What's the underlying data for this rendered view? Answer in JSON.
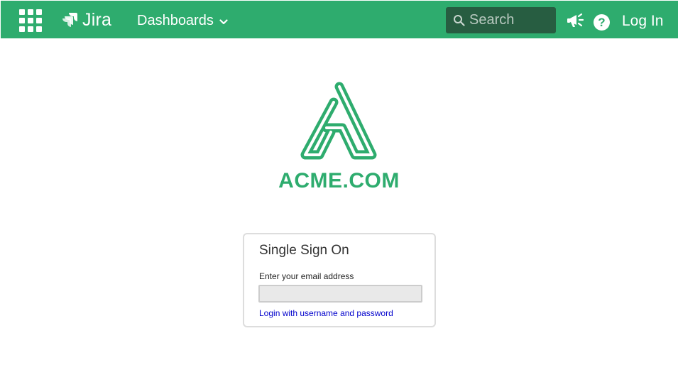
{
  "header": {
    "app_name": "Jira",
    "nav_dashboards": "Dashboards",
    "search_placeholder": "Search",
    "login_label": "Log In",
    "help_glyph": "?",
    "icons": [
      "app-switcher-icon",
      "jira-logo-icon",
      "chevron-down-icon",
      "search-icon",
      "megaphone-icon",
      "help-icon"
    ]
  },
  "brand": {
    "name": "ACME.COM",
    "color": "#2eac6e"
  },
  "sso": {
    "title": "Single Sign On",
    "email_label": "Enter your email address",
    "email_value": "",
    "alt_login_link": "Login with username and password"
  },
  "colors": {
    "header_bg": "#2eac6e",
    "search_bg": "#275d41",
    "link": "#0000cc"
  }
}
